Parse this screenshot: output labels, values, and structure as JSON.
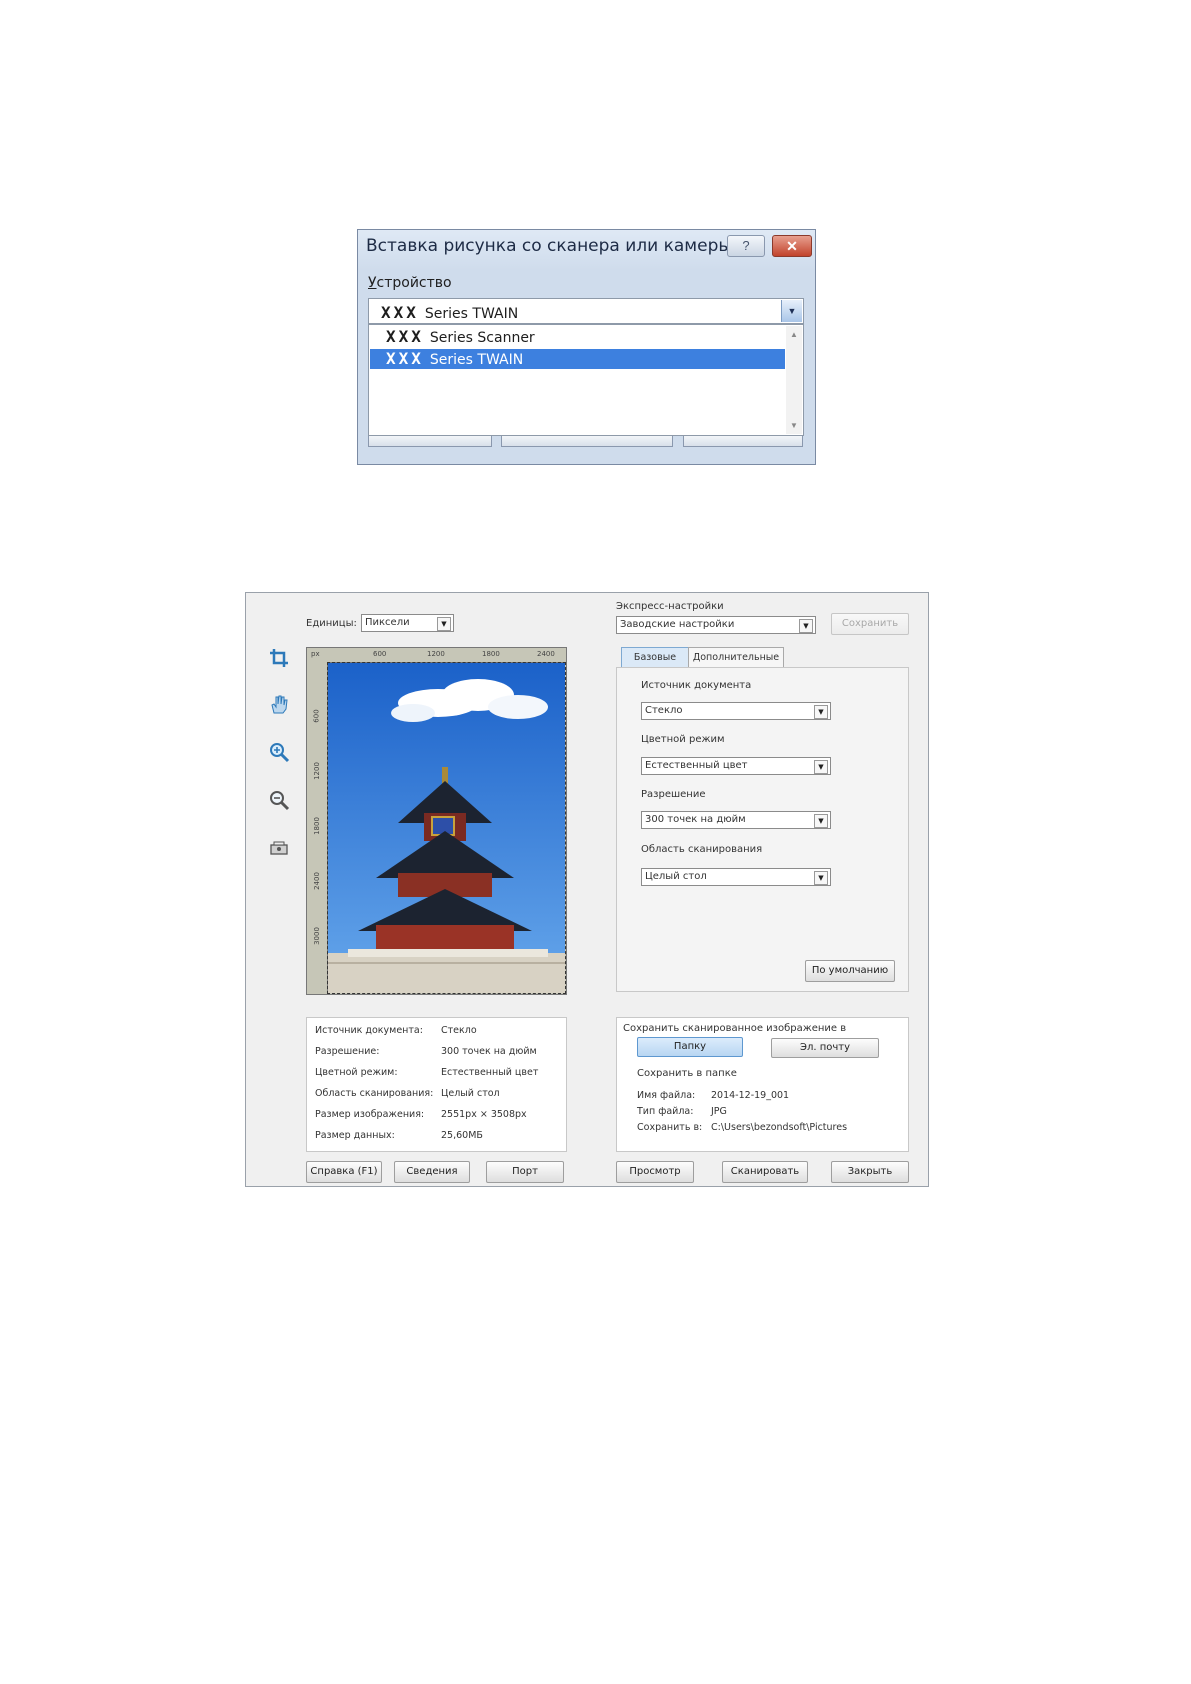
{
  "insert_dialog": {
    "title": "Вставка рисунка со сканера или камеры",
    "help_glyph": "?",
    "close_glyph": "✕",
    "device_label_first": "У",
    "device_label_rest": "стройство",
    "selected_device": {
      "prefix": "XXX",
      "name": "Series TWAIN"
    },
    "devices": [
      {
        "prefix": "XXX",
        "name": "Series Scanner"
      },
      {
        "prefix": "XXX",
        "name": "Series TWAIN"
      }
    ]
  },
  "scan_dialog": {
    "units_label": "Единицы:",
    "units_value": "Пиксели",
    "ruler_unit": "px",
    "ruler_top_ticks": [
      "600",
      "1200",
      "1800",
      "2400"
    ],
    "ruler_left_ticks": [
      "600",
      "1200",
      "1800",
      "2400",
      "3000"
    ],
    "tools": [
      "crop-icon",
      "hand-icon",
      "zoom-in-icon",
      "zoom-out-icon",
      "scanner-icon"
    ],
    "express_label": "Экспресс-настройки",
    "express_value": "Заводские настройки",
    "save_preset_label": "Сохранить",
    "tabs": [
      "Базовые",
      "Дополнительные"
    ],
    "fields": [
      {
        "label": "Источник документа",
        "value": "Стекло"
      },
      {
        "label": "Цветной режим",
        "value": "Естественный цвет"
      },
      {
        "label": "Разрешение",
        "value": "300 точек на дюйм"
      },
      {
        "label": "Область сканирования",
        "value": "Целый стол"
      }
    ],
    "default_button": "По умолчанию",
    "summary": [
      {
        "label": "Источник документа:",
        "value": "Стекло"
      },
      {
        "label": "Разрешение:",
        "value": "300 точек на дюйм"
      },
      {
        "label": "Цветной режим:",
        "value": "Естественный цвет"
      },
      {
        "label": "Область сканирования:",
        "value": "Целый стол"
      },
      {
        "label": "Размер изображения:",
        "value": "2551px × 3508px"
      },
      {
        "label": "Размер данных:",
        "value": "25,60МБ"
      }
    ],
    "save_to_label": "Сохранить сканированное изображение в",
    "save_folder_button": "Папку",
    "save_email_button": "Эл. почту",
    "save_in_folder_label": "Сохранить в папке",
    "file_info": [
      {
        "label": "Имя файла:",
        "value": "2014-12-19_001"
      },
      {
        "label": "Тип файла:",
        "value": "JPG"
      },
      {
        "label": "Сохранить в:",
        "value": "C:\\Users\\bezondsoft\\Pictures"
      }
    ],
    "bottom_buttons": {
      "help": "Справка (F1)",
      "info": "Сведения",
      "port": "Порт",
      "preview": "Просмотр",
      "scan": "Сканировать",
      "close": "Закрыть"
    }
  }
}
